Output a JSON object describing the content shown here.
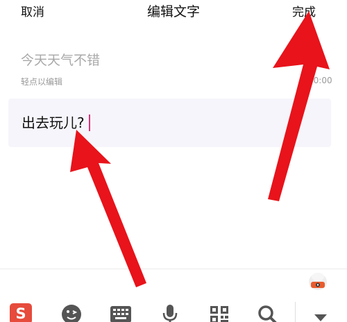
{
  "header": {
    "cancel_label": "取消",
    "title": "编辑文字",
    "done_label": "完成"
  },
  "clipboard": {
    "text": "今天天气不错",
    "hint": "轻点以编辑",
    "time": "00:00"
  },
  "editor": {
    "text": "出去玩儿?"
  },
  "keyboard_toolbar": {
    "icons": [
      "sogou-logo-icon",
      "emoji-icon",
      "keyboard-icon",
      "microphone-icon",
      "qr-code-icon",
      "search-icon",
      "chevron-down-icon"
    ]
  },
  "colors": {
    "caret": "#e0307a",
    "annotation_arrow": "#e8131b",
    "sogou_brand": "#e64b3c",
    "toolbar_icon": "#555555"
  }
}
